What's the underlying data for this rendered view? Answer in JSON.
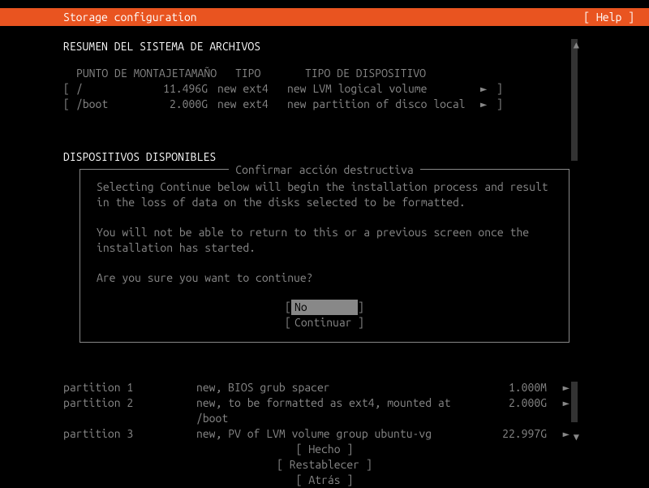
{
  "header": {
    "title": "Storage configuration",
    "help": "[ Help ]"
  },
  "fs_summary": {
    "title": "RESUMEN DEL SISTEMA DE ARCHIVOS",
    "columns": {
      "mount": "PUNTO DE MONTAJE",
      "size": "TAMAÑO",
      "type": "TIPO",
      "device": "TIPO DE DISPOSITIVO"
    },
    "rows": [
      {
        "open": "[",
        "mount": "/",
        "size": "11.496G",
        "type": "new ext4",
        "device": "new LVM logical volume",
        "arrow": "►",
        "close": "]"
      },
      {
        "open": "[",
        "mount": "/boot",
        "size": "2.000G",
        "type": "new ext4",
        "device": "new partition of disco local",
        "arrow": "►",
        "close": "]"
      }
    ]
  },
  "available": {
    "title": "DISPOSITIVOS DISPONIBLES"
  },
  "dialog": {
    "title": "Confirmar acción destructiva",
    "para1": "Selecting Continue below will begin the installation process and result in the loss of data on the disks selected to be formatted.",
    "para2": "You will not be able to return to this or a previous screen once the installation has started.",
    "para3": "Are you sure you want to continue?",
    "btn_no_open": "[",
    "btn_no": "No",
    "btn_no_close": "]",
    "btn_continue_open": "[",
    "btn_continue": "Continuar",
    "btn_continue_close": "]"
  },
  "partitions": [
    {
      "name": "partition 1",
      "desc": "new, BIOS grub spacer",
      "size": "1.000M",
      "arrow": "►"
    },
    {
      "name": "partition 2",
      "desc": "new, to be formatted as ext4, mounted at /boot",
      "size": "2.000G",
      "arrow": "►"
    },
    {
      "name": "partition 3",
      "desc": "new, PV of LVM volume group ubuntu-vg",
      "size": "22.997G",
      "arrow": "►"
    }
  ],
  "footer": {
    "done": "[ Hecho       ]",
    "reset": "[ Restablecer ]",
    "back": "[ Atrás       ]"
  },
  "glyphs": {
    "up": "▲",
    "down": "▼"
  }
}
